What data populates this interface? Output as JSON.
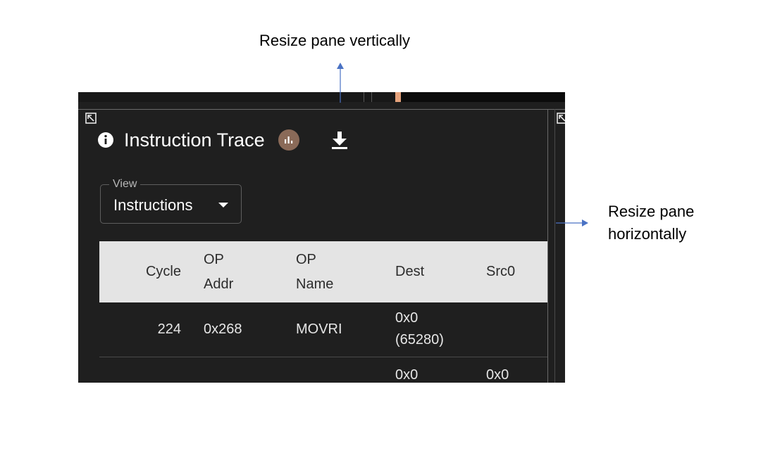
{
  "annotations": {
    "vertical_label": "Resize pane vertically",
    "horizontal_label_line1": "Resize pane",
    "horizontal_label_line2": "horizontally"
  },
  "panel": {
    "title": "Instruction Trace",
    "icons": {
      "info": "info-icon",
      "chart_badge": "bar-chart-icon",
      "download": "download-icon",
      "resize_left": "resize-icon",
      "resize_right": "resize-icon"
    },
    "view_select": {
      "label": "View",
      "value": "Instructions"
    },
    "table": {
      "columns": [
        {
          "line1": "Cycle",
          "line2": ""
        },
        {
          "line1": "OP",
          "line2": "Addr"
        },
        {
          "line1": "OP",
          "line2": "Name"
        },
        {
          "line1": "Dest",
          "line2": ""
        },
        {
          "line1": "Src0",
          "line2": ""
        }
      ],
      "rows": [
        {
          "cycle": "224",
          "op_addr": "0x268",
          "op_name": "MOVRI",
          "dest_line1": "0x0",
          "dest_line2": "(65280)",
          "src0": ""
        },
        {
          "cycle": "",
          "op_addr": "",
          "op_name": "",
          "dest_line1": "0x0",
          "dest_line2": "",
          "src0": "0x0"
        }
      ]
    }
  },
  "colors": {
    "panel_background": "#1f1f1f",
    "table_header_background": "#e4e4e4",
    "badge_background": "#8a6a58",
    "accent_marker": "#e5a27c",
    "arrow": "#4a72c4"
  }
}
